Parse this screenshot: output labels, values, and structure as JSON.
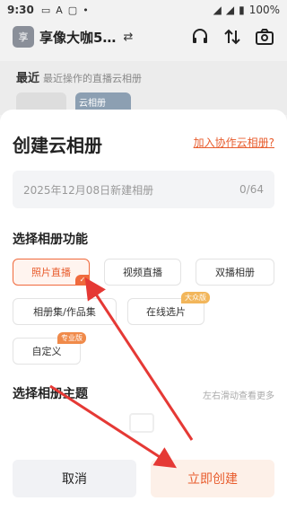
{
  "status_bar": {
    "time": "9:30",
    "battery": "100%"
  },
  "header": {
    "avatar_text": "享",
    "app_name": "享像大咖5…"
  },
  "recent": {
    "title": "最近",
    "subtitle": "最近操作的直播云相册",
    "card_label": "云相册"
  },
  "dialog": {
    "title": "创建云相册",
    "join_link": "加入协作云相册?",
    "name_placeholder": "2025年12月08日新建相册",
    "name_counter": "0/64",
    "function_title": "选择相册功能",
    "functions": [
      "照片直播",
      "视频直播",
      "双播相册",
      "相册集/作品集",
      "在线选片",
      "自定义"
    ],
    "badges": {
      "online": "大众版",
      "custom": "专业版"
    },
    "theme_title": "选择相册主题",
    "theme_hint": "左右滑动查看更多",
    "cancel_label": "取消",
    "create_label": "立即创建"
  },
  "colors": {
    "accent": "#f06a3d",
    "arrow": "#e53935"
  }
}
